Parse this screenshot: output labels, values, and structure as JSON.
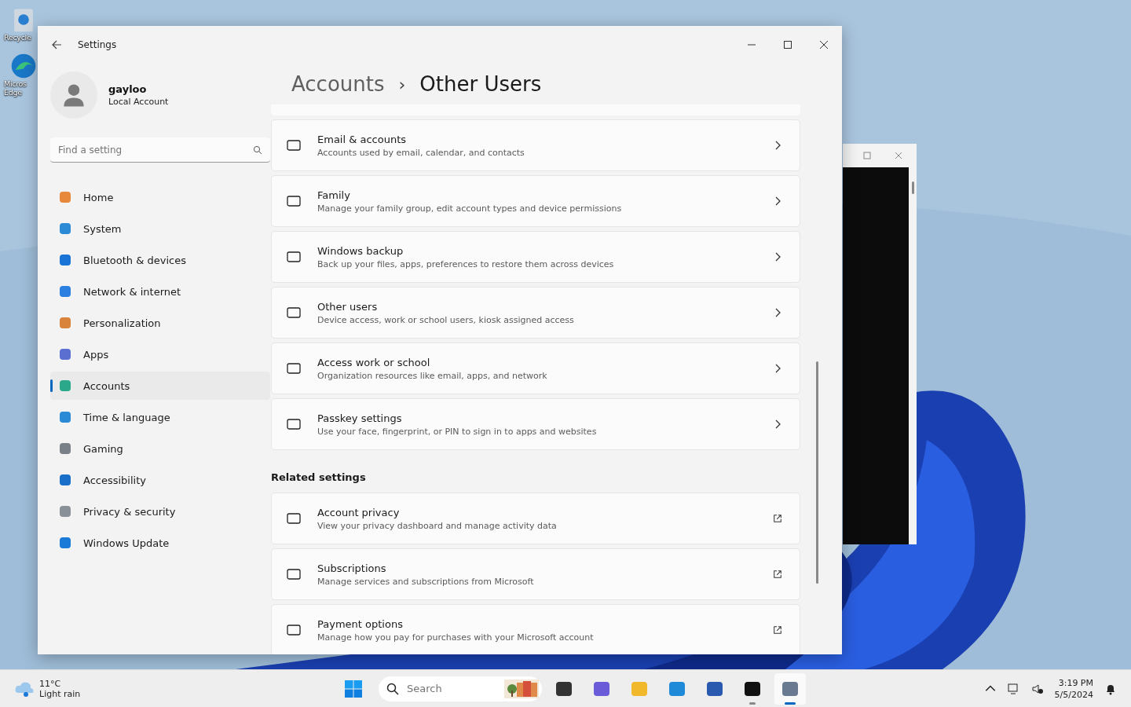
{
  "desktop_icons": [
    {
      "lines": [
        "Recycle"
      ]
    },
    {
      "lines": [
        "Micros",
        "Edge"
      ]
    }
  ],
  "window": {
    "title": "Settings"
  },
  "profile": {
    "name": "gayloo",
    "account_type": "Local Account"
  },
  "search": {
    "placeholder": "Find a setting"
  },
  "sidebar": {
    "items": [
      {
        "label": "Home",
        "selected": false
      },
      {
        "label": "System",
        "selected": false
      },
      {
        "label": "Bluetooth & devices",
        "selected": false
      },
      {
        "label": "Network & internet",
        "selected": false
      },
      {
        "label": "Personalization",
        "selected": false
      },
      {
        "label": "Apps",
        "selected": false
      },
      {
        "label": "Accounts",
        "selected": true
      },
      {
        "label": "Time & language",
        "selected": false
      },
      {
        "label": "Gaming",
        "selected": false
      },
      {
        "label": "Accessibility",
        "selected": false
      },
      {
        "label": "Privacy & security",
        "selected": false
      },
      {
        "label": "Windows Update",
        "selected": false
      }
    ]
  },
  "breadcrumb": {
    "parent": "Accounts",
    "separator": "›",
    "current": "Other Users"
  },
  "settings": [
    {
      "title": "Email & accounts",
      "description": "Accounts used by email, calendar, and contacts",
      "kind": "nav"
    },
    {
      "title": "Family",
      "description": "Manage your family group, edit account types and device permissions",
      "kind": "nav"
    },
    {
      "title": "Windows backup",
      "description": "Back up your files, apps, preferences to restore them across devices",
      "kind": "nav"
    },
    {
      "title": "Other users",
      "description": "Device access, work or school users, kiosk assigned access",
      "kind": "nav"
    },
    {
      "title": "Access work or school",
      "description": "Organization resources like email, apps, and network",
      "kind": "nav"
    },
    {
      "title": "Passkey settings",
      "description": "Use your face, fingerprint, or PIN to sign in to apps and websites",
      "kind": "nav"
    }
  ],
  "related_settings": {
    "heading": "Related settings",
    "items": [
      {
        "title": "Account privacy",
        "description": "View your privacy dashboard and manage activity data",
        "kind": "link"
      },
      {
        "title": "Subscriptions",
        "description": "Manage services and subscriptions from Microsoft",
        "kind": "link"
      },
      {
        "title": "Payment options",
        "description": "Manage how you pay for purchases with your Microsoft account",
        "kind": "link"
      }
    ]
  },
  "taskbar": {
    "weather": {
      "temperature": "11°C",
      "condition": "Light rain"
    },
    "search": {
      "placeholder": "Search"
    },
    "apps": [
      {
        "running": false,
        "active": false
      },
      {
        "running": false,
        "active": false
      },
      {
        "running": false,
        "active": false
      },
      {
        "running": false,
        "active": false
      },
      {
        "running": false,
        "active": false
      },
      {
        "running": true,
        "active": false
      },
      {
        "running": true,
        "active": true
      }
    ],
    "time": "3:19 PM",
    "date": "5/5/2024"
  }
}
